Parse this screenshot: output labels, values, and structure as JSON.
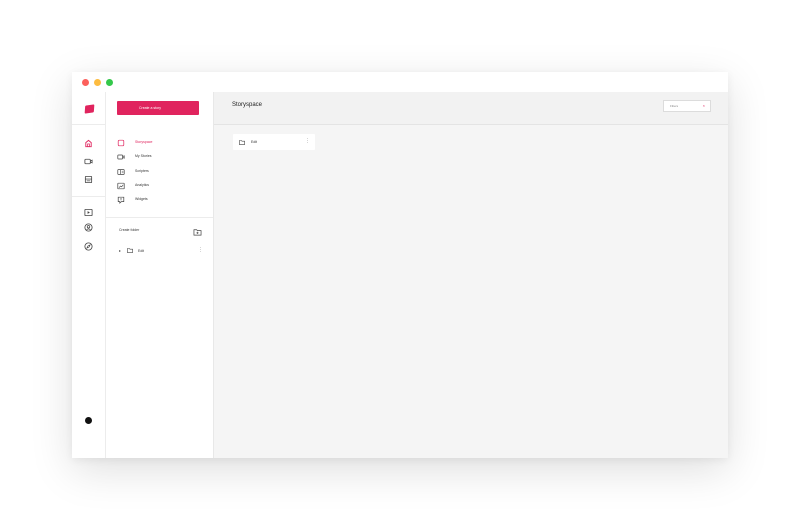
{
  "window": {
    "controls": [
      "close",
      "minimize",
      "maximize"
    ]
  },
  "rail": {
    "top_icons": [
      "home-icon",
      "video-icon",
      "scripts-icon"
    ],
    "bottom_icons": [
      "present-icon",
      "profile-icon",
      "explore-icon"
    ]
  },
  "panel": {
    "create_button": "Create a story",
    "nav": [
      {
        "label": "Storyspace",
        "icon": "storyspace-icon",
        "active": true
      },
      {
        "label": "My Stories",
        "icon": "stories-icon",
        "active": false
      },
      {
        "label": "Scripters",
        "icon": "scripters-icon",
        "active": false
      },
      {
        "label": "Analytics",
        "icon": "analytics-icon",
        "active": false
      },
      {
        "label": "Widgets",
        "icon": "widgets-icon",
        "active": false
      }
    ],
    "folders_title": "Create folder",
    "folders": [
      {
        "label": "Edit"
      }
    ]
  },
  "main": {
    "title": "Storyspace",
    "search_placeholder": "Filters",
    "cards": [
      {
        "label": "Edit"
      }
    ]
  },
  "colors": {
    "accent": "#e0245e",
    "main_bg": "#f5f5f5"
  }
}
